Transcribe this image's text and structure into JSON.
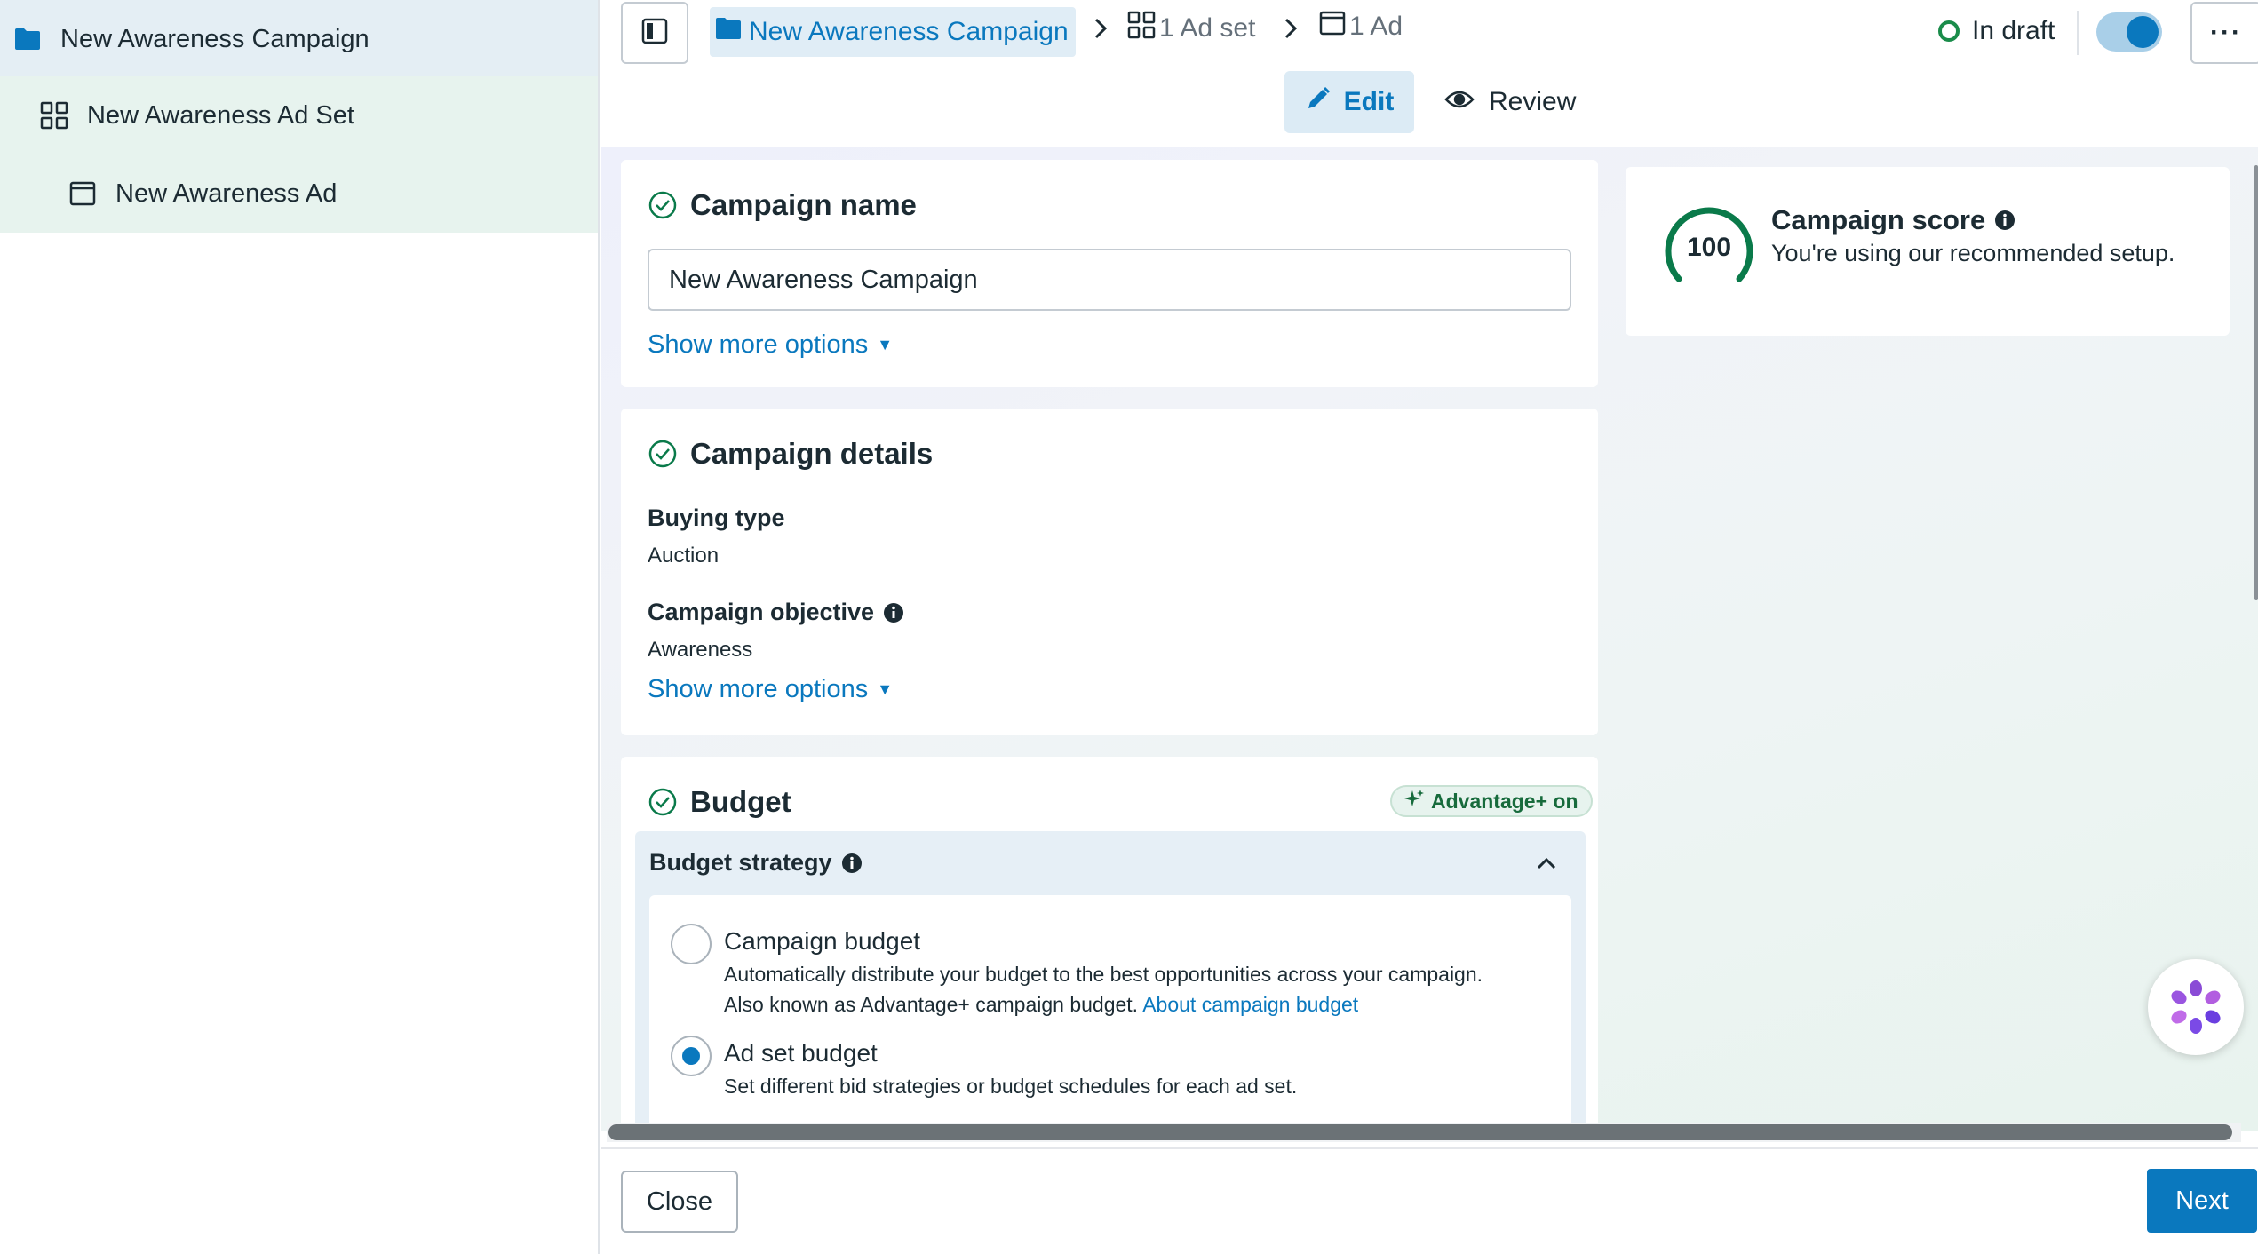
{
  "colors": {
    "accent": "#0a78be",
    "draft_status": "#1a8c4a",
    "score_green": "#0a7a4a",
    "advantage_green": "#176b3c"
  },
  "sidebar": {
    "items": [
      {
        "label": "New Awareness Campaign",
        "icon": "folder-icon"
      },
      {
        "label": "New Awareness Ad Set",
        "icon": "grid-icon"
      },
      {
        "label": "New Awareness Ad",
        "icon": "ad-window-icon"
      }
    ]
  },
  "header": {
    "breadcrumb": {
      "campaign": "New Awareness Campaign",
      "adset": "1 Ad set",
      "ad": "1 Ad"
    },
    "status": "In draft",
    "toggle_on": true,
    "more_label": "···",
    "tabs": {
      "edit": "Edit",
      "review": "Review"
    }
  },
  "campaign_name": {
    "title": "Campaign name",
    "value": "New Awareness Campaign",
    "show_more": "Show more options"
  },
  "campaign_details": {
    "title": "Campaign details",
    "buying_type_label": "Buying type",
    "buying_type_value": "Auction",
    "objective_label": "Campaign objective",
    "objective_value": "Awareness",
    "show_more": "Show more options"
  },
  "score": {
    "value": "100",
    "title": "Campaign score",
    "subtitle": "You're using our recommended setup."
  },
  "budget": {
    "title": "Budget",
    "advantage_badge": "Advantage+ on",
    "strategy_label": "Budget strategy",
    "options": [
      {
        "title": "Campaign budget",
        "desc_line1": "Automatically distribute your budget to the best opportunities across your campaign.",
        "desc_line2": "Also known as Advantage+ campaign budget.",
        "link": "About campaign budget",
        "selected": false
      },
      {
        "title": "Ad set budget",
        "desc_line1": "Set different bid strategies or budget schedules for each ad set.",
        "selected": true
      }
    ]
  },
  "footer": {
    "close": "Close",
    "next": "Next"
  }
}
